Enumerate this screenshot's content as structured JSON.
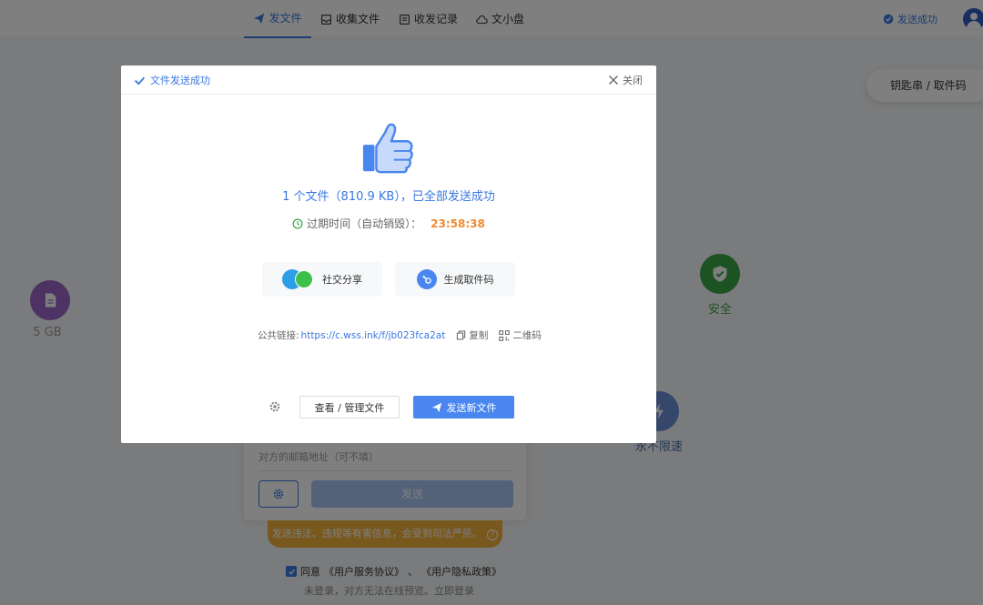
{
  "nav": {
    "tabs": [
      {
        "label": "发文件"
      },
      {
        "label": "收集文件"
      },
      {
        "label": "收发记录"
      },
      {
        "label": "文小盘"
      }
    ],
    "status": "发送成功"
  },
  "keybox": {
    "label": "钥匙串 / 取件码"
  },
  "features": {
    "storage": {
      "label": "5 GB"
    },
    "safe": {
      "label": "安全"
    },
    "speed": {
      "label": "永不限速"
    }
  },
  "bg_form": {
    "email_placeholder": "对方的邮箱地址（可不填）",
    "send_label": "发送",
    "warning": "发送违法、违规等有害信息，会受到司法严惩。",
    "agree_prefix": "同意",
    "terms": "《用户服务协议》",
    "separator": "、",
    "privacy": "《用户隐私政策》",
    "not_logged": "未登录，对方无法在线预览。立即登录"
  },
  "modal": {
    "title": "文件发送成功",
    "close_label": "关闭",
    "message": "1 个文件（810.9 KB），已全部发送成功",
    "expire_label": "过期时间（自动销毁）：",
    "expire_time": "23:58:38",
    "share_label": "社交分享",
    "code_label": "生成取件码",
    "link_label": "公共链接:",
    "link_url": "https://c.wss.ink/f/jb023fca2at",
    "copy_label": "复制",
    "qr_label": "二维码",
    "manage_label": "查看 / 管理文件",
    "new_label": "发送新文件"
  },
  "colors": {
    "primary": "#3a78e0",
    "accent_orange": "#f0892f",
    "storage_purple": "#9a67c9",
    "safe_green": "#3aa546",
    "warning_yellow": "#f2b03a"
  }
}
